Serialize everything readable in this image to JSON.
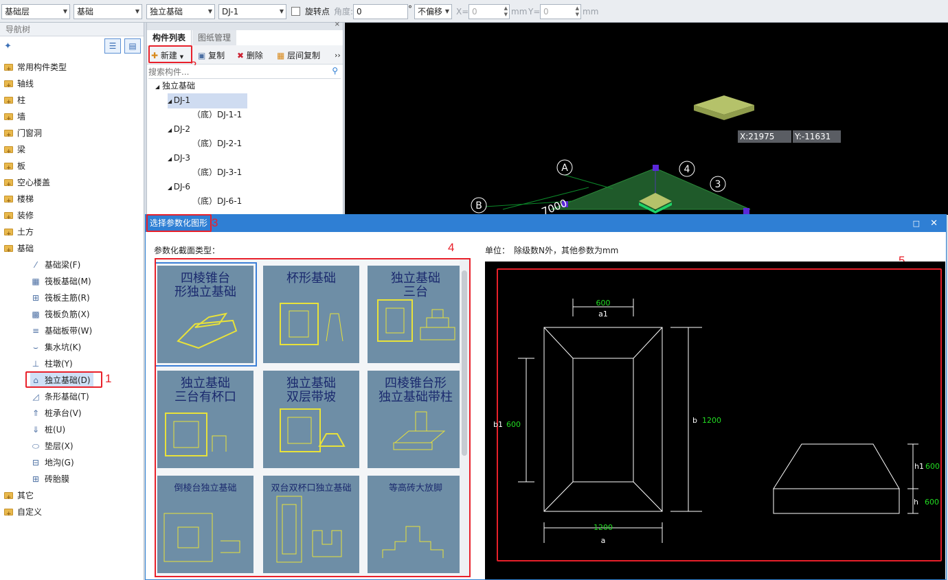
{
  "toolbar": {
    "floor": "基础层",
    "type": "基础",
    "category": "独立基础",
    "component": "DJ-1",
    "rotate_label": "旋转点",
    "angle_label": "角度:",
    "angle_value": "0",
    "degree": "°",
    "offset": "不偏移",
    "x_label": "X=",
    "x_value": "0",
    "mm1": "mm",
    "y_label": "Y=",
    "y_value": "0",
    "mm2": "mm"
  },
  "nav": {
    "title": "导航树",
    "folders": [
      "常用构件类型",
      "轴线",
      "柱",
      "墙",
      "门窗洞",
      "梁",
      "板",
      "空心楼盖",
      "楼梯",
      "装修",
      "土方",
      "基础"
    ],
    "children": [
      "基础梁(F)",
      "筏板基础(M)",
      "筏板主筋(R)",
      "筏板负筋(X)",
      "基础板带(W)",
      "集水坑(K)",
      "柱墩(Y)",
      "独立基础(D)",
      "条形基础(T)",
      "桩承台(V)",
      "桩(U)",
      "垫层(X)",
      "地沟(G)",
      "砖胎膜"
    ],
    "tail": [
      "其它",
      "自定义"
    ]
  },
  "comp": {
    "tab_list": "构件列表",
    "tab_drawing": "图纸管理",
    "new": "新建",
    "copy": "复制",
    "delete": "删除",
    "floor_copy": "层间复制",
    "more": "››",
    "search_placeholder": "搜索构件...",
    "root": "独立基础",
    "items": [
      {
        "name": "DJ-1",
        "sub": "（底）DJ-1-1"
      },
      {
        "name": "DJ-2",
        "sub": "（底）DJ-2-1"
      },
      {
        "name": "DJ-3",
        "sub": "（底）DJ-3-1"
      },
      {
        "name": "DJ-6",
        "sub": "（底）DJ-6-1"
      }
    ]
  },
  "viewport": {
    "coord_x": "X:21975",
    "coord_y": "Y:-11631",
    "axis_a": "A",
    "axis_b": "B",
    "axis_3": "3",
    "axis_4": "4",
    "dim": "7000"
  },
  "dialog": {
    "title": "选择参数化图形",
    "section_label": "参数化截面类型：",
    "unit_label": "单位：",
    "unit_text": "除级数N外，其他参数为mm",
    "thumbs": [
      "四棱锥台形独立基础",
      "杯形基础",
      "独立基础三台",
      "独立基础三台有杯口",
      "独立基础双层带坡",
      "四棱锥台形独立基础带柱",
      "倒棱台独立基础",
      "双台双杯口独立基础",
      "等高砖大放脚"
    ],
    "thumb_lines": [
      [
        "四棱锥台",
        "形独立基础"
      ],
      [
        "杯形基础"
      ],
      [
        "独立基础",
        "三台"
      ],
      [
        "独立基础",
        "三台有杯口"
      ],
      [
        "独立基础",
        "双层带坡"
      ],
      [
        "四棱锥台形",
        "独立基础带柱"
      ],
      [
        "倒棱台独立基础"
      ],
      [
        "双台双杯口独立基础"
      ],
      [
        "等高砖大放脚"
      ]
    ],
    "preview": {
      "a1": "600",
      "a1_lbl": "a1",
      "a": "1200",
      "a_lbl": "a",
      "b1_lbl": "b1",
      "b1": "600",
      "b_lbl": "b",
      "b": "1200",
      "h1_lbl": "h1",
      "h1": "600",
      "h_lbl": "h",
      "h": "600"
    }
  },
  "annotations": [
    "1",
    "2",
    "3",
    "4",
    "5"
  ],
  "colors": {
    "accent": "#2f7fd4",
    "highlight": "#e8202a",
    "dim_green": "#22dd22"
  }
}
